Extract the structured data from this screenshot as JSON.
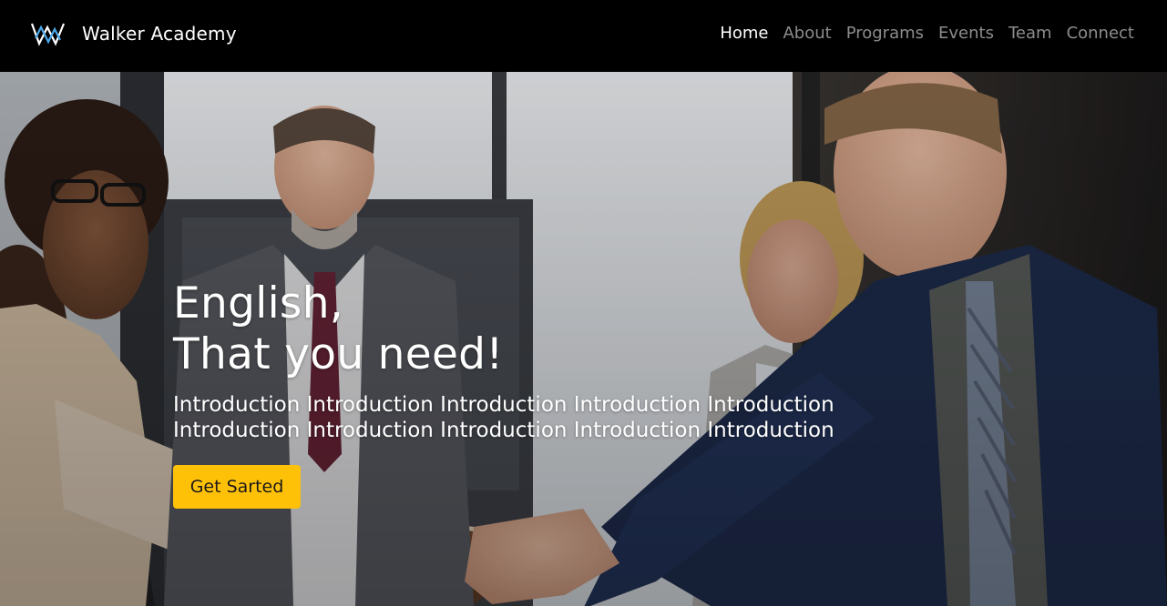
{
  "brand": {
    "name": "Walker Academy",
    "logo_icon": "walker-w-logo",
    "logo_colors": [
      "#ffffff",
      "#4aa8e8"
    ]
  },
  "nav": {
    "items": [
      {
        "label": "Home",
        "active": true
      },
      {
        "label": "About",
        "active": false
      },
      {
        "label": "Programs",
        "active": false
      },
      {
        "label": "Events",
        "active": false
      },
      {
        "label": "Team",
        "active": false
      },
      {
        "label": "Connect",
        "active": false
      }
    ]
  },
  "hero": {
    "title_line1": "English,",
    "title_line2": "That you need!",
    "intro": "Introduction Introduction Introduction Introduction Introduction Introduction Introduction Introduction Introduction Introduction",
    "button_label": "Get Sarted",
    "background_image": "office-handshake-photo"
  },
  "colors": {
    "navbar_bg": "#000000",
    "nav_active": "#ffffff",
    "nav_inactive": "#8c8c8c",
    "cta_bg": "#ffc107",
    "cta_text": "#1a1a1a"
  }
}
